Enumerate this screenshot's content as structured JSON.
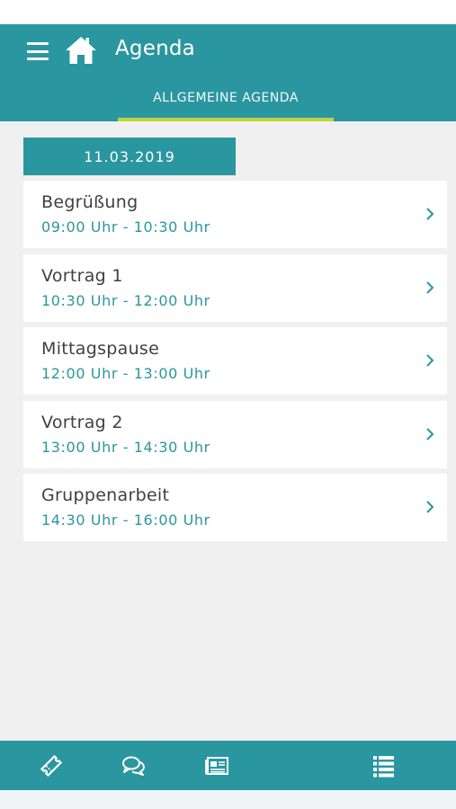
{
  "header": {
    "title": "Agenda",
    "menu_icon": "hamburger-menu-icon",
    "home_icon": "home-icon"
  },
  "tabs": [
    {
      "label": "ALLGEMEINE AGENDA",
      "active": true
    }
  ],
  "date": "11.03.2019",
  "agenda": [
    {
      "name": "Begrüßung",
      "time": "09:00 Uhr - 10:30 Uhr"
    },
    {
      "name": "Vortrag 1",
      "time": "10:30 Uhr - 12:00 Uhr"
    },
    {
      "name": "Mittagspause",
      "time": "12:00 Uhr - 13:00 Uhr"
    },
    {
      "name": "Vortrag 2",
      "time": "13:00 Uhr - 14:30 Uhr"
    },
    {
      "name": "Gruppenarbeit",
      "time": "14:30 Uhr - 16:00 Uhr"
    }
  ],
  "bottom_nav": [
    {
      "icon": "ticket-icon"
    },
    {
      "icon": "chat-bubbles-icon"
    },
    {
      "icon": "newspaper-icon"
    },
    {
      "icon": "agenda-list-icon",
      "active": true
    }
  ],
  "colors": {
    "primary": "#2a969f",
    "accent": "#bcd43d",
    "background": "#f0f0f0",
    "title_text": "#404040"
  }
}
